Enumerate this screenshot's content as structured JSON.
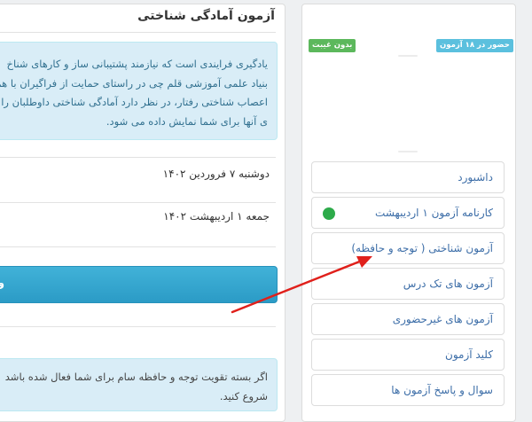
{
  "sidebar": {
    "badges": {
      "attendance": "حضور در ۱۸ آزمون",
      "absence": "بدون غیبت"
    },
    "items": [
      {
        "label": "داشبورد"
      },
      {
        "label": "کارنامه آزمون ۱ اردیبهشت",
        "status_color": "#2dab4a"
      },
      {
        "label": "آزمون شناختی ( توجه و حافظه)"
      },
      {
        "label": "آزمون های تک درس"
      },
      {
        "label": "آزمون های غیرحضوری"
      },
      {
        "label": "کلید آزمون"
      },
      {
        "label": "سوال و پاسخ آزمون ها"
      }
    ]
  },
  "main": {
    "title": "آزمون آمادگی شناختی",
    "intro_lines": [
      "یادگیری فرایندی است که نیازمند پشتیبانی ساز و کارهای شناخ",
      "بنیاد علمی آموزشی قلم چی در راستای حمایت از فراگیران با هم",
      "اعصاب شناختی رفتار، در نظر دارد آمادگی شناختی داوطلبان را ب",
      "ی آنها برای شما نمایش داده می شود."
    ],
    "dates": [
      "دوشنبه ۷ فروردین ۱۴۰۲",
      "جمعه ۱ اردیبهشت ۱۴۰۲"
    ],
    "start_button_fragment": "و",
    "package_lines": [
      "اگر بسته تقویت توجه و حافظه سام برای شما فعال شده باشد",
      "شروع کنید."
    ]
  },
  "colors": {
    "accent_blue": "#3d6ea8",
    "info_bg": "#d9edf7",
    "start_bar": "#2b9bc6",
    "arrow": "#e0201b"
  }
}
